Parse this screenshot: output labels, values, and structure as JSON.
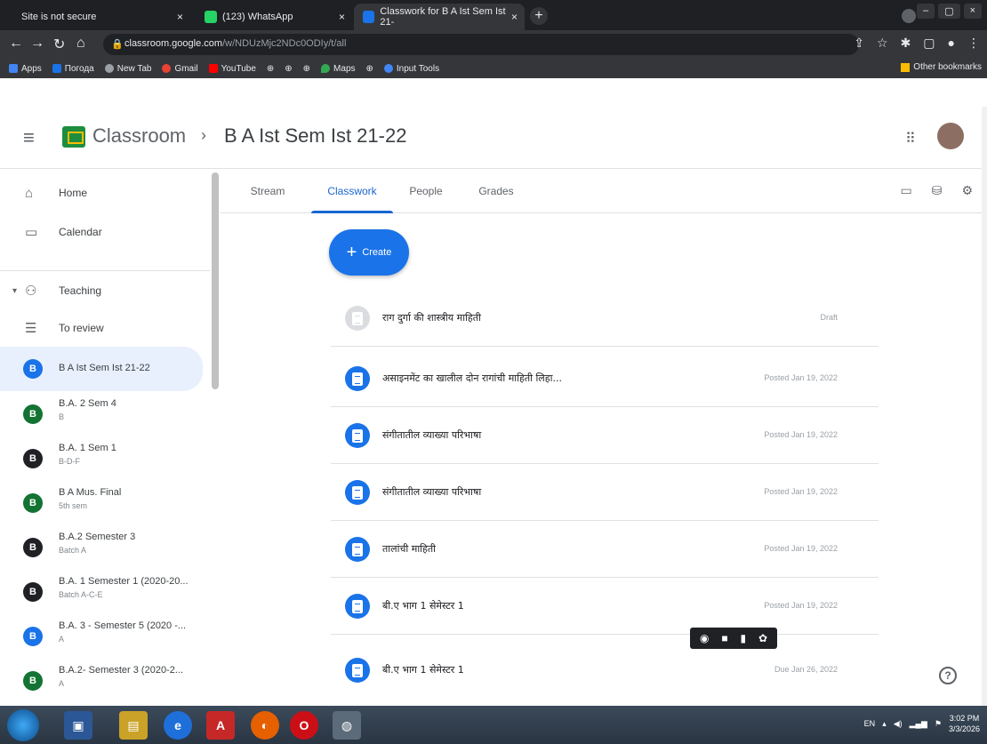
{
  "browser": {
    "tabs": [
      {
        "label": "Site is not secure",
        "close": "×"
      },
      {
        "label": "(123) WhatsApp",
        "close": "×"
      },
      {
        "label": "Classwork for B A Ist Sem Ist 21-",
        "close": "×"
      }
    ],
    "new_tab": "+",
    "window_controls": [
      "–",
      "▢",
      "×"
    ],
    "url_host": "classroom.google.com",
    "url_path": "/w/NDUzMjc2NDc0ODIy/t/all",
    "bookmarks": [
      {
        "label": "Apps",
        "color": "#4285f4"
      },
      {
        "label": "Погода",
        "color": "#1a73e8"
      },
      {
        "label": "New Tab",
        "color": "#9aa0a6"
      },
      {
        "label": "Gmail",
        "color": "#ea4335"
      },
      {
        "label": "YouTube",
        "color": "#ff0000"
      },
      {
        "label": "Maps",
        "color": "#34a853"
      },
      {
        "label": "Input Tools",
        "color": "#4285f4"
      }
    ],
    "other_bookmarks": "Other bookmarks"
  },
  "header": {
    "app_title": "Classroom",
    "separator": "›",
    "class_name": "B A Ist Sem Ist 21-22"
  },
  "sidebar": {
    "items": [
      {
        "label": "Home",
        "icon": "home-icon"
      },
      {
        "label": "Calendar",
        "icon": "calendar-icon"
      },
      {
        "label": "Teaching",
        "icon": "people-icon"
      },
      {
        "label": "To review",
        "icon": "review-icon"
      }
    ],
    "classes": [
      {
        "letter": "B",
        "title": "B A Ist Sem Ist 21-22",
        "sub": "",
        "color": "#1a73e8"
      },
      {
        "letter": "B",
        "title": "B.A. 2 Sem 4",
        "sub": "B",
        "color": "#137333"
      },
      {
        "letter": "B",
        "title": "B.A. 1 Sem 1",
        "sub": "B-D-F",
        "color": "#202124"
      },
      {
        "letter": "B",
        "title": "B A Mus. Final",
        "sub": "5th sem",
        "color": "#137333"
      },
      {
        "letter": "B",
        "title": "B.A.2 Semester 3",
        "sub": "Batch A",
        "color": "#202124"
      },
      {
        "letter": "B",
        "title": "B.A. 1 Semester 1 (2020-20...",
        "sub": "Batch A-C-E",
        "color": "#202124"
      },
      {
        "letter": "B",
        "title": "B.A. 3 - Semester 5 (2020 -...",
        "sub": "A",
        "color": "#1a73e8"
      },
      {
        "letter": "B",
        "title": "B.A.2- Semester 3 (2020-2...",
        "sub": "A",
        "color": "#137333"
      }
    ]
  },
  "tabs": [
    {
      "label": "Stream"
    },
    {
      "label": "Classwork"
    },
    {
      "label": "People"
    },
    {
      "label": "Grades"
    }
  ],
  "create_label": "Create",
  "classwork": [
    {
      "title": "राग दुर्गा की शास्त्रीय माहिती",
      "meta": "Draft"
    },
    {
      "title": "असाइनमेंट का खालील दोन रागांची माहिती लिहा...",
      "meta": "Posted Jan 19, 2022"
    },
    {
      "title": "संगीतातील व्याख्या परिभाषा",
      "meta": "Posted Jan 19, 2022"
    },
    {
      "title": "संगीतातील व्याख्या परिभाषा",
      "meta": "Posted Jan 19, 2022"
    },
    {
      "title": "तालांची माहिती",
      "meta": "Posted Jan 19, 2022"
    },
    {
      "title": "बी.ए भाग 1 सेमेस्टर 1",
      "meta": "Posted Jan 19, 2022"
    },
    {
      "title": "बी.ए भाग 1 सेमेस्टर 1",
      "meta": "Due Jan 26, 2022"
    }
  ],
  "help": "?",
  "taskbar": {
    "lang": "EN",
    "time": "3:02 PM",
    "date": "3/3/2026"
  }
}
